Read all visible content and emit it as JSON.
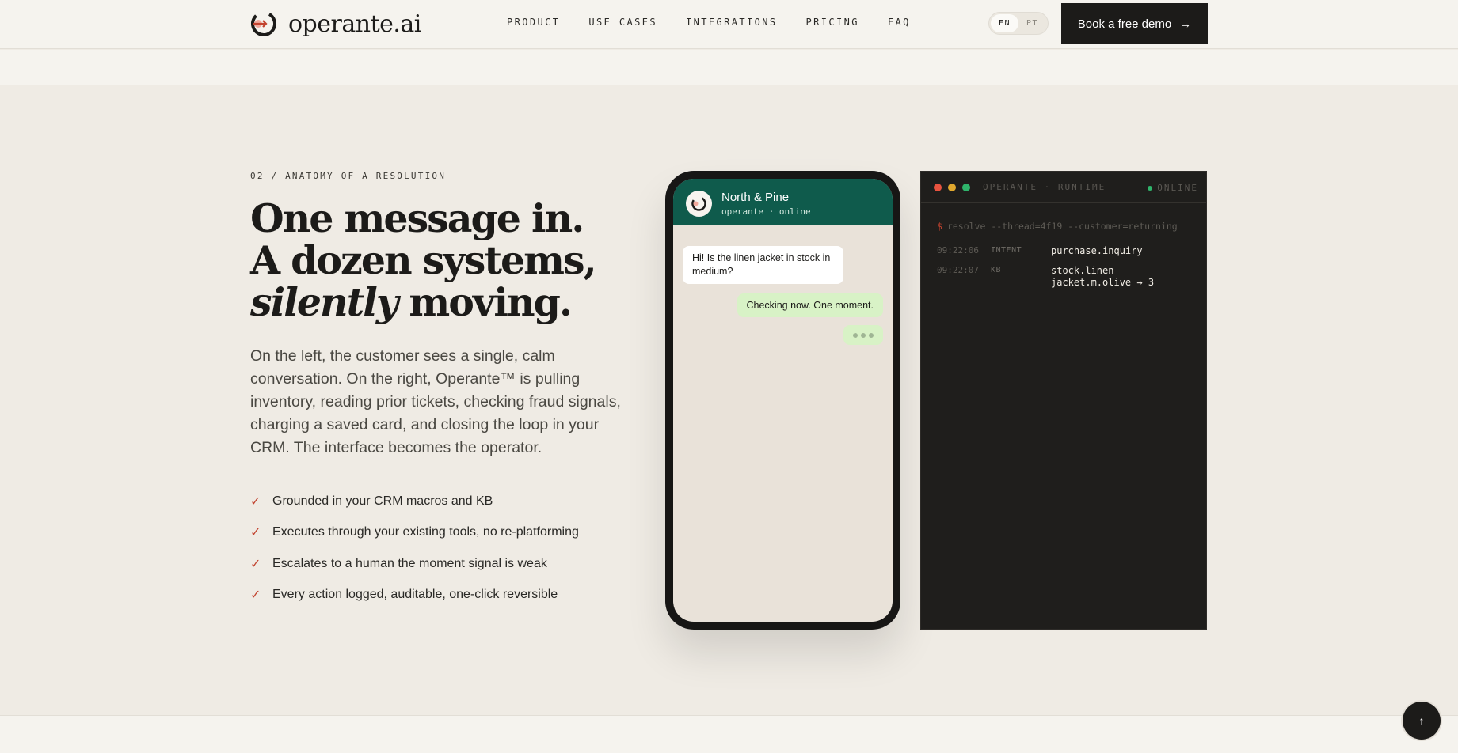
{
  "header": {
    "logo_text": "operante.ai",
    "nav": [
      "PRODUCT",
      "USE CASES",
      "INTEGRATIONS",
      "PRICING",
      "FAQ"
    ],
    "lang": {
      "en": "EN",
      "pt": "PT"
    },
    "demo_label": "Book a free demo",
    "demo_arrow": "→"
  },
  "section": {
    "eyebrow": "02 / ANATOMY OF A RESOLUTION",
    "headline_line1": "One message in.",
    "headline_line2": "A dozen systems,",
    "headline_em": "silently",
    "headline_tail": " moving.",
    "lede": "On the left, the customer sees a single, calm conversation. On the right, Operante™ is pulling inventory, reading prior tickets, checking fraud signals, charging a saved card, and closing the loop in your CRM. The interface becomes the operator.",
    "checks": [
      "Grounded in your CRM macros and KB",
      "Executes through your existing tools, no re-platforming",
      "Escalates to a human the moment signal is weak",
      "Every action logged, auditable, one-click reversible"
    ],
    "check_glyph": "✓"
  },
  "phone": {
    "name": "North & Pine",
    "status": "operante · online",
    "msg_in": "Hi! Is the linen jacket in stock in medium?",
    "msg_out": "Checking now. One moment."
  },
  "terminal": {
    "title": "OPERANTE · RUNTIME",
    "online": "ONLINE",
    "prompt": "$",
    "command": "resolve --thread=4f19 --customer=returning",
    "logs": [
      {
        "time": "09:22:06",
        "tag": "INTENT",
        "msg": "purchase.inquiry"
      },
      {
        "time": "09:22:07",
        "tag": "KB",
        "msg": "stock.linen-jacket.m.olive → 3"
      }
    ],
    "colors": {
      "red": "#e8533f",
      "yellow": "#e0a82e",
      "green": "#2fb46b"
    }
  },
  "scroll_top": "↑"
}
